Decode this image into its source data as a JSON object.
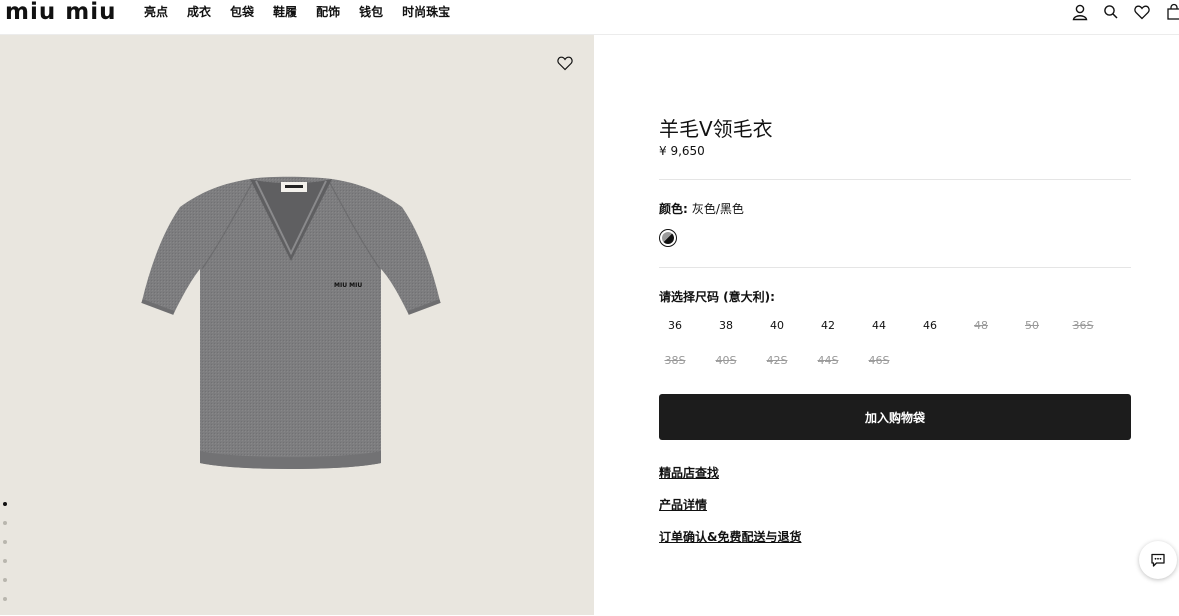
{
  "header": {
    "logo": "miu miu",
    "nav": [
      "亮点",
      "成衣",
      "包袋",
      "鞋履",
      "配饰",
      "钱包",
      "时尚珠宝"
    ],
    "icons": [
      "user-icon",
      "search-icon",
      "heart-icon",
      "shopping-bag-icon"
    ]
  },
  "gallery": {
    "wishlist_icon": "heart-icon",
    "image": "grey-v-neck-short-sleeve-sweater",
    "image_label": "MIU MIU",
    "dots": {
      "count": 6,
      "active": 0
    }
  },
  "product": {
    "title": "羊毛V领毛衣",
    "price": "¥ 9,650",
    "color_label": "颜色:",
    "color_value": "灰色/黑色",
    "swatch_colors": [
      "#9a9a9a",
      "#111111"
    ],
    "size_label": "请选择尺码 (意大利):",
    "sizes": [
      {
        "label": "36",
        "available": true
      },
      {
        "label": "38",
        "available": true
      },
      {
        "label": "40",
        "available": true
      },
      {
        "label": "42",
        "available": true
      },
      {
        "label": "44",
        "available": true
      },
      {
        "label": "46",
        "available": true
      },
      {
        "label": "48",
        "available": false
      },
      {
        "label": "50",
        "available": false
      },
      {
        "label": "36S",
        "available": false
      },
      {
        "label": "38S",
        "available": false
      },
      {
        "label": "40S",
        "available": false
      },
      {
        "label": "42S",
        "available": false
      },
      {
        "label": "44S",
        "available": false
      },
      {
        "label": "46S",
        "available": false
      }
    ],
    "add_to_bag": "加入购物袋",
    "links": [
      "精品店查找",
      "产品详情",
      "订单确认&免费配送与退货"
    ]
  },
  "chat": {
    "icon": "chat-icon"
  },
  "colors": {
    "gallery_bg": "#e9e6df",
    "button_bg": "#1c1c1c",
    "sweater": "#7d7d7f"
  }
}
